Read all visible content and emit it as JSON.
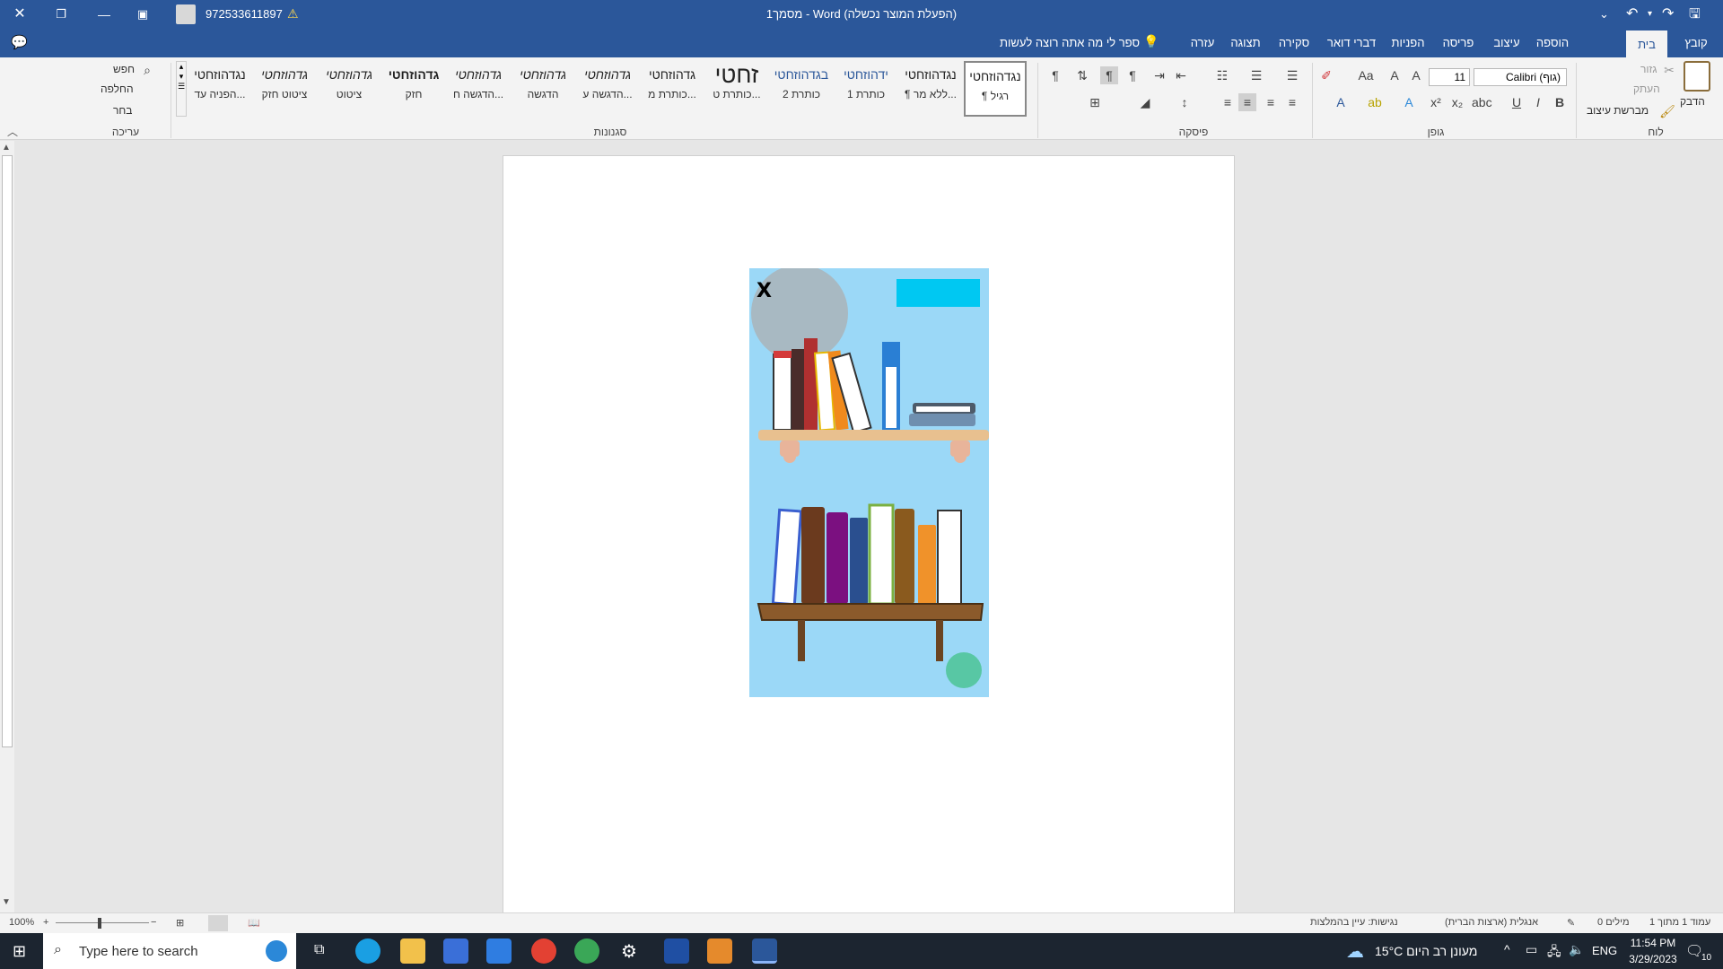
{
  "title_bar": {
    "doc_title": "מסמך1  -  Word (הפעלת המוצר נכשלה)",
    "account": "972533611897"
  },
  "tabs": [
    "קובץ",
    "בית",
    "הוספה",
    "עיצוב",
    "פריסה",
    "הפניות",
    "דברי דואר",
    "סקירה",
    "תצוגה",
    "עזרה"
  ],
  "active_tab": "בית",
  "tell_me": "ספר לי מה אתה רוצה לעשות",
  "ribbon": {
    "clipboard": {
      "paste": "הדבק",
      "cut": "גזור",
      "copy": "העתק",
      "format_painter": "מברשת עיצוב",
      "label": "לוח"
    },
    "font": {
      "name": "Calibri (גוף)",
      "size": "11",
      "label": "גופן",
      "bold": "B",
      "italic": "I",
      "underline": "U"
    },
    "paragraph": {
      "label": "פיסקה"
    },
    "styles": {
      "label": "סגנונות",
      "items": [
        {
          "preview": "נגדהוזחטי",
          "name": "¶ רגיל"
        },
        {
          "preview": "נגדהוזחטי",
          "name": "¶ ללא מר..."
        },
        {
          "preview": "ידהוזחטי",
          "name": "כותרת 1"
        },
        {
          "preview": "בגדהוזחטי",
          "name": "כותרת 2"
        },
        {
          "preview": "זחטי",
          "name": "כותרת ט..."
        },
        {
          "preview": "גדהוזחטי",
          "name": "כותרת מ..."
        },
        {
          "preview": "גדהוזחטי",
          "name": "הדגשה ע..."
        },
        {
          "preview": "גדהוזחטי",
          "name": "הדגשה"
        },
        {
          "preview": "גדהוזחטי",
          "name": "הדגשה ח..."
        },
        {
          "preview": "גדהוזחטי",
          "name": "חזק"
        },
        {
          "preview": "גדהוזחטי",
          "name": "ציטוט"
        },
        {
          "preview": "גדהוזחטי",
          "name": "ציטוט חזק"
        },
        {
          "preview": "נגדהוזחטי",
          "name": "הפניה עד..."
        }
      ]
    },
    "editing": {
      "find": "חפש",
      "replace": "החלפה",
      "select": "בחר",
      "label": "עריכה"
    }
  },
  "document": {
    "close_mark": "X",
    "colors": {
      "scene_bg": "#9bd8f7",
      "accent_rect": "#00c8f2",
      "grey_circle": "#a8b9c2",
      "teal_circle": "#58c7a4"
    }
  },
  "status_bar": {
    "page": "עמוד 1 מתוך 1",
    "words": "0 מילים",
    "language": "אנגלית (ארצות הברית)",
    "accessibility": "נגישות: עיין בהמלצות",
    "zoom": "100%"
  },
  "taskbar": {
    "search_placeholder": "Type here to search",
    "weather": "15°C  מעונן רב היום",
    "lang": "ENG",
    "time": "11:54 PM",
    "date": "3/29/2023",
    "notifications": "10"
  }
}
